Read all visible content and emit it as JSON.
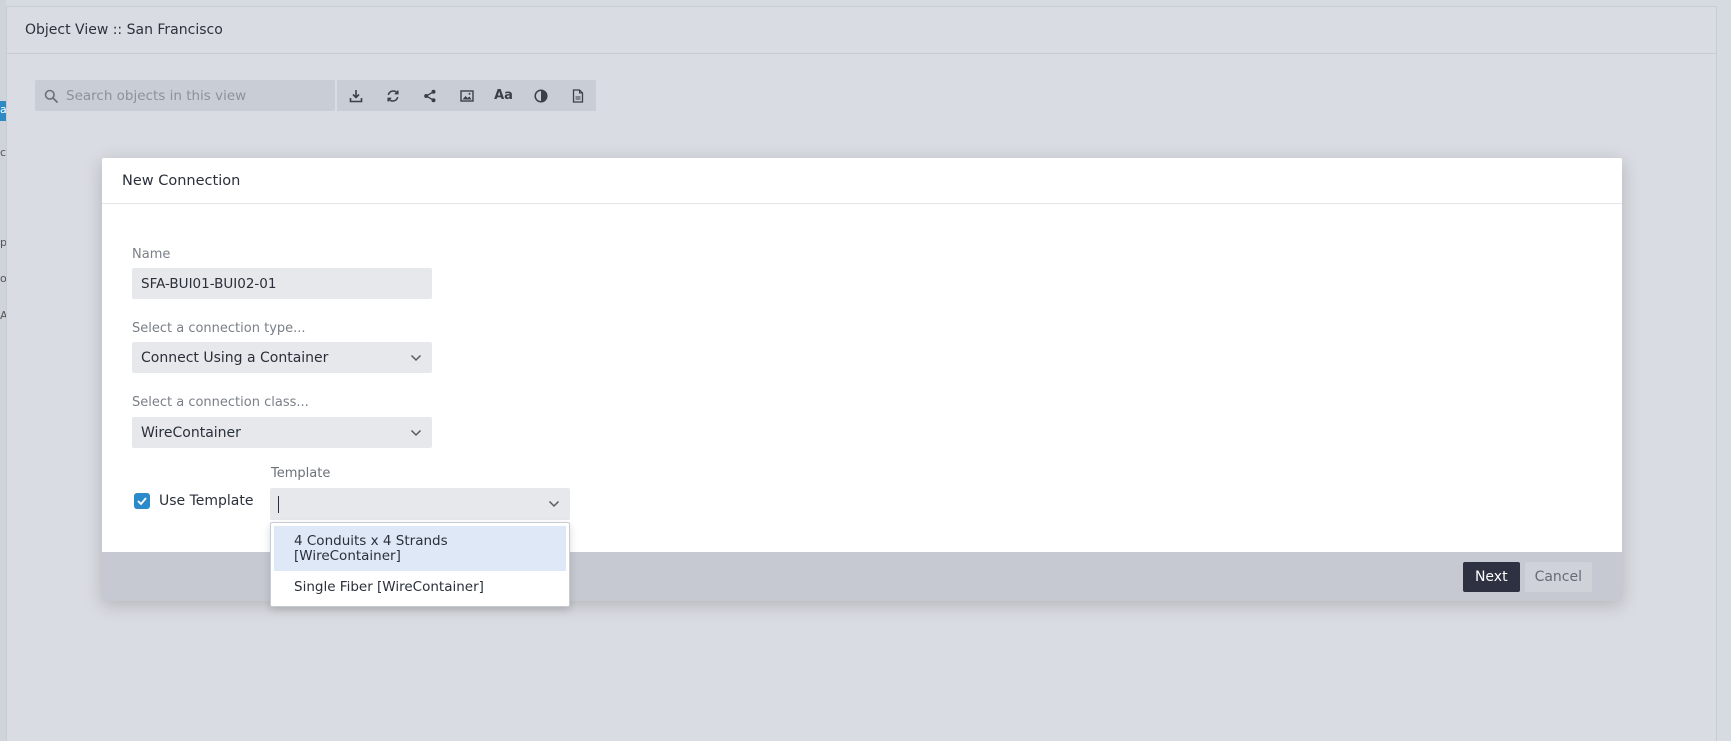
{
  "window": {
    "title": "Object View :: San Francisco"
  },
  "toolbar": {
    "search_placeholder": "Search objects in this view",
    "tools": [
      {
        "icon": "download-icon"
      },
      {
        "icon": "refresh-icon"
      },
      {
        "icon": "share-icon"
      },
      {
        "icon": "image-icon"
      },
      {
        "icon": "text-size-icon",
        "glyph": "Aa"
      },
      {
        "icon": "contrast-icon"
      },
      {
        "icon": "document-icon"
      }
    ]
  },
  "background_fragments": [
    "a",
    "c",
    "p",
    "o",
    "A"
  ],
  "modal": {
    "title": "New Connection",
    "name_label": "Name",
    "name_value": "SFA-BUI01-BUI02-01",
    "type_label": "Select a connection type...",
    "type_value": "Connect Using a Container",
    "class_label": "Select a connection class...",
    "class_value": "WireContainer",
    "use_template_label": "Use Template",
    "use_template_checked": true,
    "template_label": "Template",
    "template_value": "",
    "template_options": [
      "4 Conduits x 4 Strands [WireContainer]",
      "Single Fiber [WireContainer]"
    ],
    "next_label": "Next",
    "cancel_label": "Cancel"
  },
  "colors": {
    "accent": "#2b8ac9",
    "primary_button": "#2e3142",
    "footer": "#c6c9d1",
    "highlight": "#dfe8f7"
  }
}
